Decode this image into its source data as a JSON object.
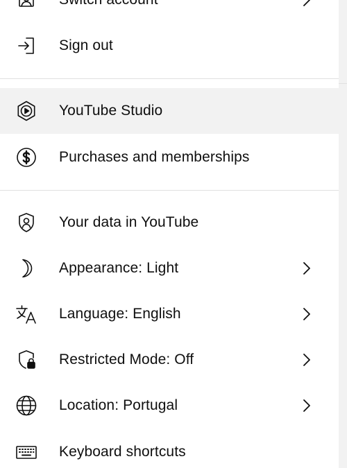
{
  "menu": {
    "items": [
      {
        "label": "Switch account",
        "icon": "switch-account-icon",
        "has_chevron": true
      },
      {
        "label": "Sign out",
        "icon": "sign-out-icon",
        "has_chevron": false
      },
      {
        "label": "YouTube Studio",
        "icon": "youtube-studio-icon",
        "has_chevron": false,
        "highlighted": true
      },
      {
        "label": "Purchases and memberships",
        "icon": "dollar-icon",
        "has_chevron": false
      },
      {
        "label": "Your data in YouTube",
        "icon": "shield-person-icon",
        "has_chevron": false
      },
      {
        "label": "Appearance: Light",
        "icon": "moon-icon",
        "has_chevron": true
      },
      {
        "label": "Language: English",
        "icon": "translate-icon",
        "has_chevron": true
      },
      {
        "label": "Restricted Mode: Off",
        "icon": "restricted-mode-icon",
        "has_chevron": true
      },
      {
        "label": "Location: Portugal",
        "icon": "globe-icon",
        "has_chevron": true
      },
      {
        "label": "Keyboard shortcuts",
        "icon": "keyboard-icon",
        "has_chevron": false
      }
    ]
  },
  "colors": {
    "text": "#0f0f0f",
    "highlight_bg": "#f2f2f2",
    "divider": "#e0e0e0",
    "background": "#ffffff"
  }
}
